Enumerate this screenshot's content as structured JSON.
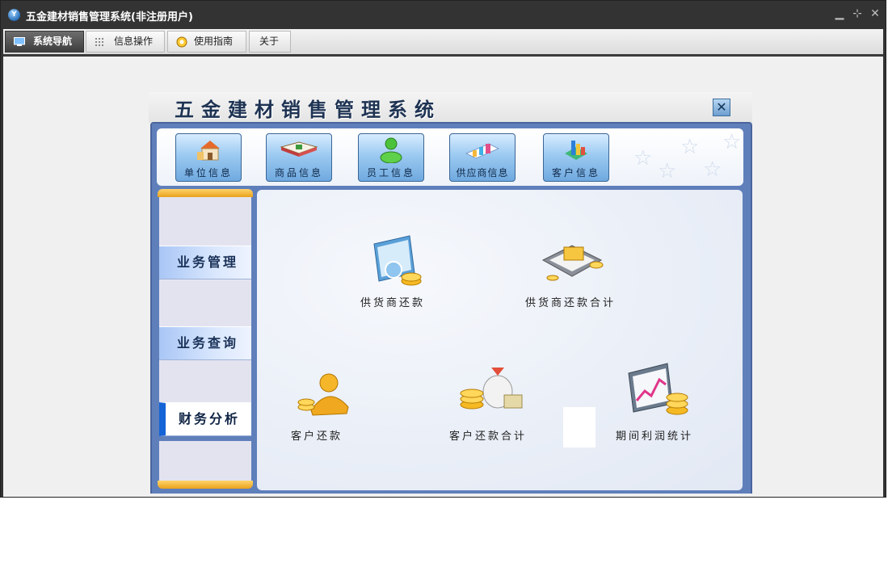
{
  "window": {
    "title": "五金建材销售管理系统(非注册用户)",
    "app_icon_text": "Y",
    "controls": {
      "minimize": "▁",
      "restore": "⊹",
      "close": "✕"
    }
  },
  "menu": {
    "tabs": [
      {
        "label": "系统导航",
        "icon": "monitor-icon",
        "active": true
      },
      {
        "label": "信息操作",
        "icon": "grid-icon",
        "active": false
      },
      {
        "label": "使用指南",
        "icon": "help-icon",
        "active": false
      },
      {
        "label": "关于",
        "icon": "",
        "active": false
      }
    ]
  },
  "panel": {
    "title": "五金建材销售管理系统",
    "close": "✕"
  },
  "toolbar": {
    "buttons": [
      {
        "label": "单位信息",
        "icon": "building-icon"
      },
      {
        "label": "商品信息",
        "icon": "book-icon"
      },
      {
        "label": "员工信息",
        "icon": "person-icon"
      },
      {
        "label": "供应商信息",
        "icon": "supplier-icon"
      },
      {
        "label": "客户信息",
        "icon": "customer-icon"
      }
    ]
  },
  "sidebar": {
    "items": [
      {
        "label": "业务管理",
        "active": false
      },
      {
        "label": "业务查询",
        "active": false
      },
      {
        "label": "财务分析",
        "active": true
      }
    ]
  },
  "modules": [
    {
      "label": "供货商还款",
      "icon": "supplier-payment-icon"
    },
    {
      "label": "供货商还款合计",
      "icon": "supplier-payment-total-icon"
    },
    {
      "label": "客户还款",
      "icon": "customer-payment-icon"
    },
    {
      "label": "客户还款合计",
      "icon": "customer-payment-total-icon"
    },
    {
      "label": "期间利润统计",
      "icon": "profit-chart-icon"
    }
  ],
  "colors": {
    "titlebar": "#333333",
    "panel_frame": "#5f7fbb",
    "active_accent": "#1463d6",
    "sidebar_cap": "#e9a21d"
  }
}
